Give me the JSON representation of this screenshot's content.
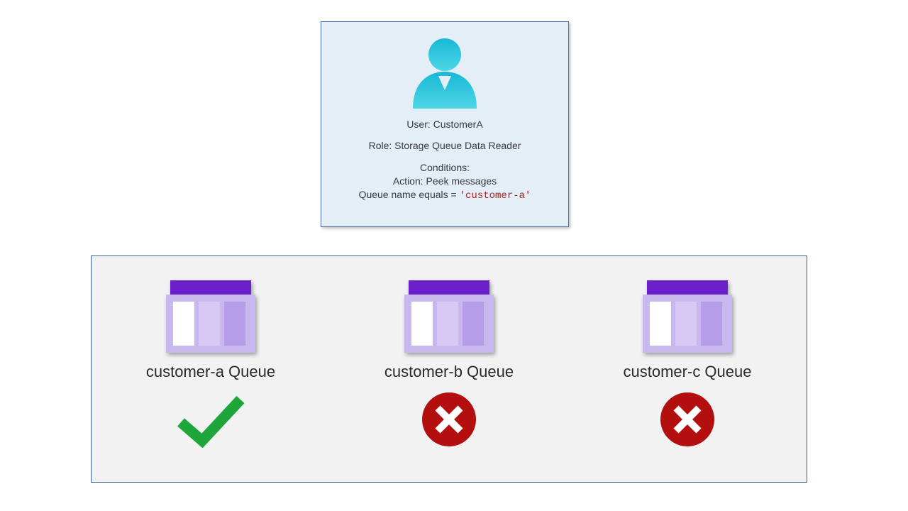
{
  "user_card": {
    "user_label_prefix": "User: ",
    "user_name": "CustomerA",
    "role_label_prefix": "Role: ",
    "role_name": "Storage Queue Data Reader",
    "conditions_heading": "Conditions:",
    "action_line": "Action: Peek messages",
    "condition_prefix": "Queue name equals = ",
    "condition_value": "'customer-a'"
  },
  "queues": [
    {
      "label": "customer-a Queue",
      "access": "allowed"
    },
    {
      "label": "customer-b Queue",
      "access": "denied"
    },
    {
      "label": "customer-c Queue",
      "access": "denied"
    }
  ],
  "icons": {
    "user_color_top": "#18b8d8",
    "user_color_bottom": "#4ed6e5",
    "queue_header": "#6a1fc9",
    "queue_body": "#c9b8ee",
    "queue_cell_light": "#ffffff",
    "queue_cell_mid": "#d7c9f4",
    "queue_cell_dark": "#b59de8",
    "check_color": "#1fa63a",
    "deny_color": "#b30f0f"
  }
}
